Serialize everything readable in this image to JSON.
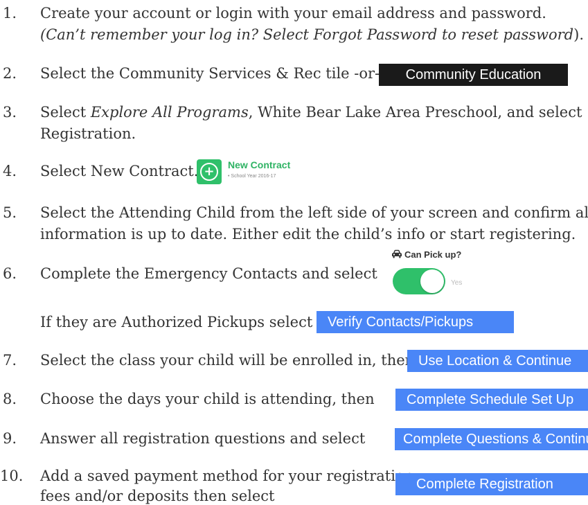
{
  "steps": [
    {
      "num": "1.",
      "line1": "Create your account or login with your email address and password.",
      "line2_italic": "(Can’t remember your log in? Select Forgot Password to reset password",
      "line2_tail": ")."
    },
    {
      "num": "2.",
      "text": "Select the Community Services & Rec tile -or-",
      "button": "Community Education"
    },
    {
      "num": "3.",
      "pre": "Select ",
      "italic": "Explore All Programs",
      "post": ", White Bear Lake Area Preschool, and select",
      "line2": "Registration."
    },
    {
      "num": "4.",
      "text": "Select New Contract.",
      "widget_title": "New Contract",
      "widget_sub": "• School Year 2016-17"
    },
    {
      "num": "5.",
      "line1": "Select the Attending Child from the left side of your screen and confirm all",
      "line2": "information is up to date. Either edit the child’s info or start registering."
    },
    {
      "num": "6.",
      "text": "Complete the Emergency Contacts and select",
      "pickup_label": "Can Pick up?",
      "toggle_label": "Yes",
      "line2": "If they are Authorized Pickups select",
      "button": "Verify Contacts/Pickups"
    },
    {
      "num": "7.",
      "text": "Select the class your child will be enrolled in, then",
      "button": "Use Location & Continue"
    },
    {
      "num": "8.",
      "text": "Choose the days your child is attending, then",
      "button": "Complete Schedule Set Up"
    },
    {
      "num": "9.",
      "text": "Answer all registration questions and select",
      "button": "Complete Questions & Continue"
    },
    {
      "num": "10.",
      "line1": "Add a saved payment method for your registration",
      "line2": "fees and/or deposits then select",
      "button": "Complete Registration"
    }
  ],
  "icons": {
    "plus": "+",
    "car": "car-icon"
  },
  "colors": {
    "text": "#333333",
    "dark_button": "#1a1a1a",
    "blue_button": "#4a86f7",
    "green": "#2fc06a"
  }
}
